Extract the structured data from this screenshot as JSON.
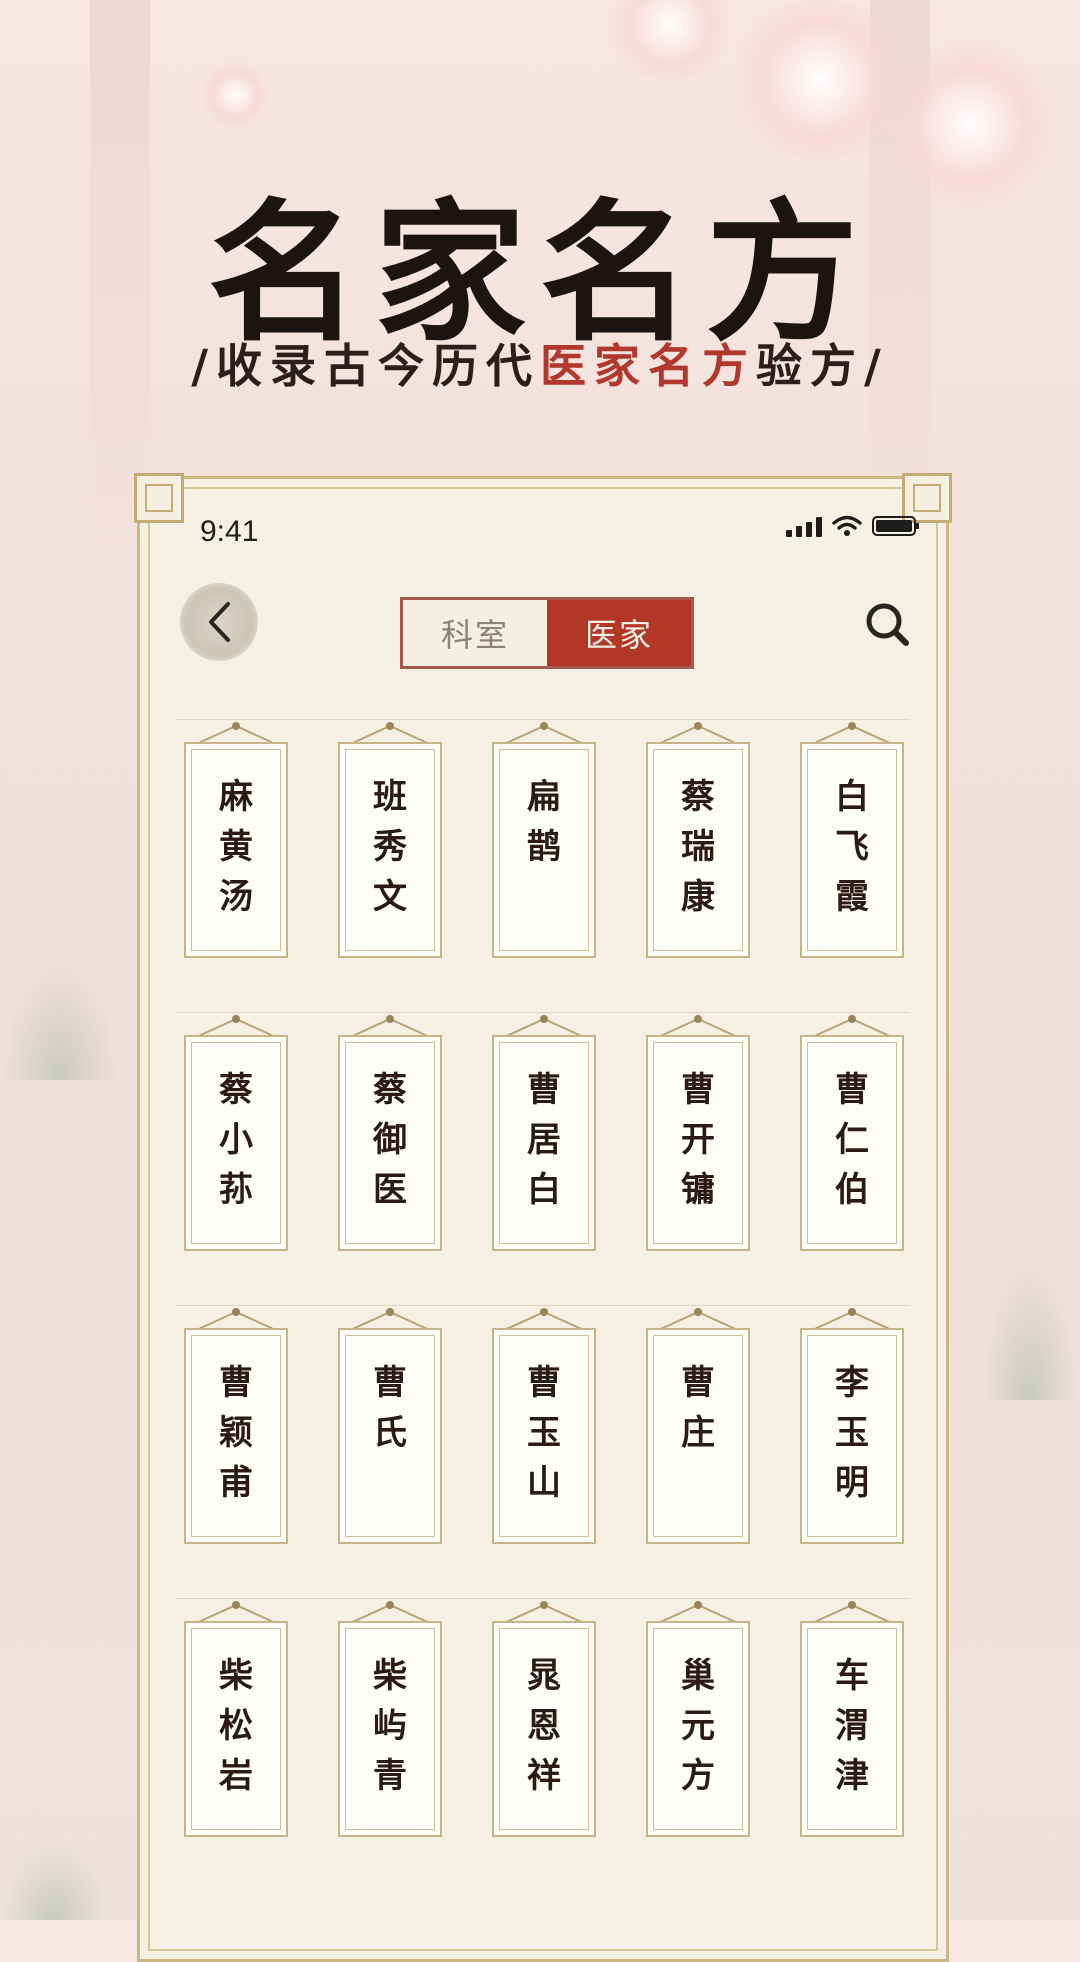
{
  "hero": {
    "title": "名家名方",
    "subtitle_prefix": "/收录古今历代",
    "subtitle_highlight": "医家名方",
    "subtitle_suffix": "验方/"
  },
  "status_bar": {
    "time": "9:41"
  },
  "header": {
    "back_icon": "chevron-left-icon",
    "tabs": [
      {
        "label": "科室",
        "active": false
      },
      {
        "label": "医家",
        "active": true
      }
    ],
    "search_icon": "search-icon"
  },
  "doctors": [
    [
      "麻黄汤",
      "班秀文",
      "扁鹊",
      "蔡瑞康",
      "白飞霞"
    ],
    [
      "蔡小荪",
      "蔡御医",
      "曹居白",
      "曹开镛",
      "曹仁伯"
    ],
    [
      "曹颖甫",
      "曹氏",
      "曹玉山",
      "曹庄",
      "李玉明"
    ],
    [
      "柴松岩",
      "柴屿青",
      "晁恩祥",
      "巢元方",
      "车渭津"
    ]
  ],
  "colors": {
    "accent_red": "#b33627",
    "frame_gold": "#c7b487",
    "paper": "#f5f0e4"
  }
}
